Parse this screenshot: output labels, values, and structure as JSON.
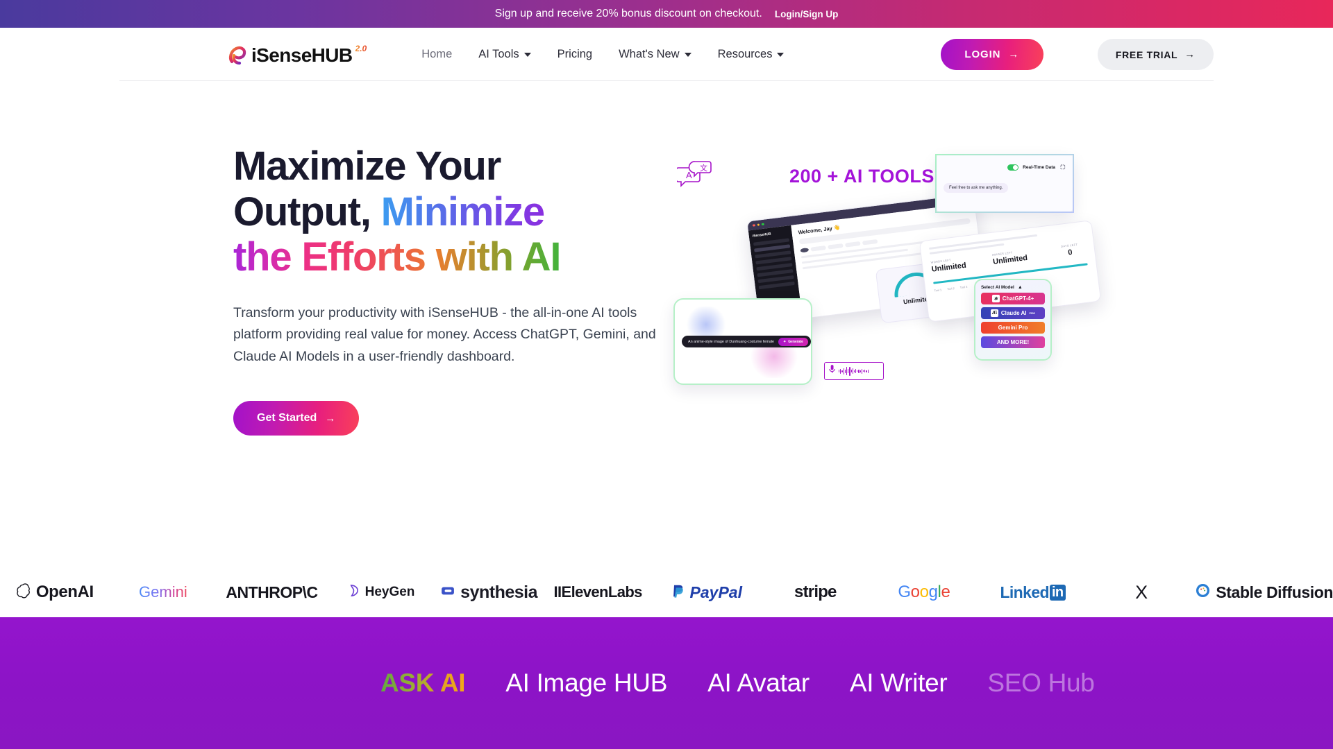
{
  "announcement": {
    "text": "Sign up and receive 20% bonus discount on checkout.",
    "link_label": "Login/Sign Up"
  },
  "header": {
    "logo_text": "iSenseHUB",
    "logo_superscript": "2.0",
    "nav": [
      {
        "label": "Home",
        "has_caret": false,
        "active": true
      },
      {
        "label": "AI Tools",
        "has_caret": true,
        "active": false
      },
      {
        "label": "Pricing",
        "has_caret": false,
        "active": false
      },
      {
        "label": "What's New",
        "has_caret": true,
        "active": false
      },
      {
        "label": "Resources",
        "has_caret": true,
        "active": false
      }
    ],
    "login_label": "LOGIN",
    "trial_label": "FREE TRIAL",
    "arrow": "→"
  },
  "hero": {
    "headline_line1": "Maximize Your",
    "headline_line2a": "Output, ",
    "headline_line2b": "Minimize",
    "headline_line3": "the Efforts with AI",
    "description": "Transform your productivity with iSenseHUB - the all-in-one AI tools platform providing real value for money. Access ChatGPT, Gemini, and Claude AI Models in a user-friendly dashboard.",
    "cta_label": "Get Started",
    "cta_arrow": "→"
  },
  "hero_art": {
    "tools_badge": "200 + AI TOOLS",
    "dashboard": {
      "sidebar_logo": "iSenseHUB",
      "welcome": "Welcome, Jay 👋"
    },
    "usage_panel": {
      "col1_label": "WORDS LEFT",
      "col1_value": "Unlimited",
      "col2_label": "IMAGES LEFT",
      "col2_value": "Unlimited",
      "col3_label": "DAYS LEFT",
      "col3_value": "0",
      "legend": [
        "Tool 1",
        "Tool 2",
        "Tool 3"
      ]
    },
    "gauge_label": "Unlimited",
    "image_gen": {
      "prompt": "An anime-style image of Dunhuang-costume female",
      "generate_label": "Generate"
    },
    "realtime_card": {
      "title": "Real-Time Data",
      "message": "Feel free to ask me anything.",
      "toggle_state": "on"
    },
    "models_card": {
      "title": "Select AI Model",
      "caret": "▲",
      "items": [
        {
          "label": "ChatGPT-4+",
          "badge": ""
        },
        {
          "label": "Claude AI",
          "badge": "PRO"
        },
        {
          "label": "Gemini Pro",
          "badge": ""
        },
        {
          "label": "AND MORE!",
          "badge": ""
        }
      ]
    }
  },
  "logo_strip": [
    {
      "name": "OpenAI"
    },
    {
      "name": "Gemini"
    },
    {
      "name": "ANTHROP\\C"
    },
    {
      "name": "HeyGen"
    },
    {
      "name": "synthesia"
    },
    {
      "name": "IIElevenLabs"
    },
    {
      "name": "PayPal"
    },
    {
      "name": "stripe"
    },
    {
      "name": "Google"
    },
    {
      "name": "Linked"
    },
    {
      "name": "in"
    },
    {
      "name": "X"
    },
    {
      "name": "Stable Diffusion"
    }
  ],
  "marquee": {
    "items": [
      {
        "label": "ASK AI",
        "style": "gradient"
      },
      {
        "label": "AI Image HUB",
        "style": "solid"
      },
      {
        "label": "AI Avatar",
        "style": "solid"
      },
      {
        "label": "AI Writer",
        "style": "solid"
      },
      {
        "label": "SEO Hub",
        "style": "faded"
      }
    ]
  },
  "colors": {
    "brand_purple": "#9415cd",
    "brand_magenta": "#a413d9",
    "accent_pink": "#e81f7d",
    "headline_dark": "#1a1a2e",
    "toggle_green": "#2fc45e"
  }
}
